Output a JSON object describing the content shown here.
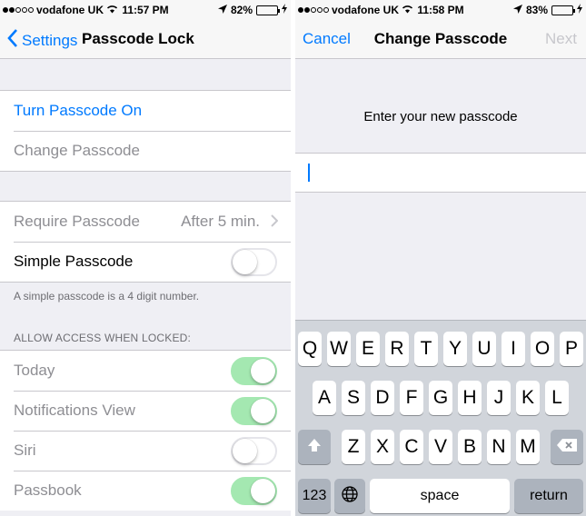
{
  "left": {
    "status": {
      "carrier": "vodafone UK",
      "time": "11:57 PM",
      "battery": "82%",
      "battery_level": 0.82
    },
    "nav": {
      "back_label": "Settings",
      "title": "Passcode Lock"
    },
    "group1": {
      "turn_on": "Turn Passcode On",
      "change": "Change Passcode"
    },
    "group2": {
      "require_label": "Require Passcode",
      "require_value": "After 5 min.",
      "simple_label": "Simple Passcode",
      "simple_on": false
    },
    "footnote": "A simple passcode is a 4 digit number.",
    "access_header": "ALLOW ACCESS WHEN LOCKED:",
    "access_items": [
      {
        "label": "Today",
        "on": true
      },
      {
        "label": "Notifications View",
        "on": true
      },
      {
        "label": "Siri",
        "on": false
      },
      {
        "label": "Passbook",
        "on": true
      }
    ]
  },
  "right": {
    "status": {
      "carrier": "vodafone UK",
      "time": "11:58 PM",
      "battery": "83%",
      "battery_level": 0.83
    },
    "nav": {
      "cancel": "Cancel",
      "title": "Change Passcode",
      "next": "Next"
    },
    "prompt": "Enter your new passcode",
    "keyboard": {
      "row1": [
        "Q",
        "W",
        "E",
        "R",
        "T",
        "Y",
        "U",
        "I",
        "O",
        "P"
      ],
      "row2": [
        "A",
        "S",
        "D",
        "F",
        "G",
        "H",
        "J",
        "K",
        "L"
      ],
      "row3": [
        "Z",
        "X",
        "C",
        "V",
        "B",
        "N",
        "M"
      ],
      "numbers": "123",
      "space": "space",
      "return": "return"
    }
  },
  "colors": {
    "accent": "#007aff",
    "switch_on": "#4cd964",
    "disabled_text": "#8e8e93"
  }
}
